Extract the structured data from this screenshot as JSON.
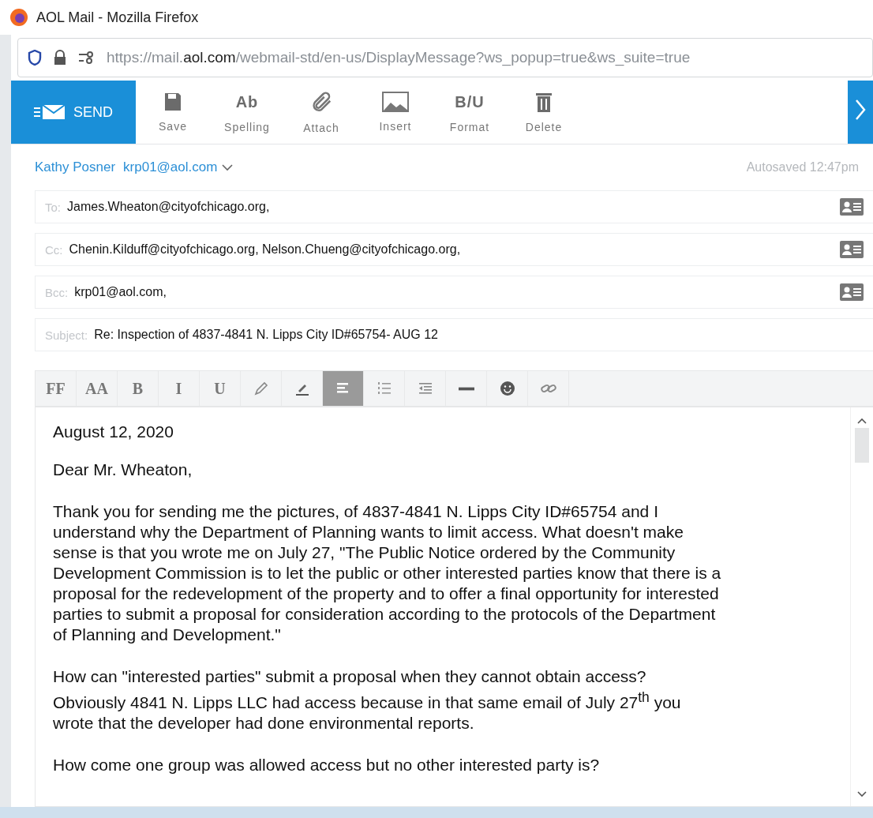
{
  "window": {
    "title": "AOL Mail - Mozilla Firefox"
  },
  "address_bar": {
    "url_start": "https://mail.",
    "url_domain": "aol.com",
    "url_rest": "/webmail-std/en-us/DisplayMessage?ws_popup=true&ws_suite=true"
  },
  "toolbar": {
    "send": "SEND",
    "actions": [
      {
        "label": "Save"
      },
      {
        "label": "Spelling",
        "glyph": "Ab"
      },
      {
        "label": "Attach"
      },
      {
        "label": "Insert"
      },
      {
        "label": "Format",
        "glyph": "B/U"
      },
      {
        "label": "Delete"
      }
    ]
  },
  "sender": {
    "name": "Kathy Posner",
    "email": "krp01@aol.com",
    "autosaved": "Autosaved 12:47pm"
  },
  "fields": [
    {
      "label": "To:",
      "value": "James.Wheaton@cityofchicago.org,",
      "contacts": true
    },
    {
      "label": "Cc:",
      "value": "Chenin.Kilduff@cityofchicago.org, Nelson.Chueng@cityofchicago.org,",
      "contacts": true
    },
    {
      "label": "Bcc:",
      "value": "krp01@aol.com,",
      "contacts": true
    },
    {
      "label": "Subject:",
      "value": "Re: Inspection of 4837-4841 N. Lipps City  ID#65754- AUG 12",
      "contacts": false
    }
  ],
  "format_bar": [
    {
      "kind": "text",
      "label": "FF",
      "selected": false
    },
    {
      "kind": "text",
      "label": "AA",
      "selected": false
    },
    {
      "kind": "text",
      "label": "B",
      "selected": false
    },
    {
      "kind": "text",
      "label": "I",
      "selected": false
    },
    {
      "kind": "text",
      "label": "U",
      "selected": false
    },
    {
      "kind": "icon",
      "selected": false
    },
    {
      "kind": "icon",
      "selected": false
    },
    {
      "kind": "icon",
      "selected": true
    },
    {
      "kind": "icon",
      "selected": false
    },
    {
      "kind": "icon",
      "selected": false
    },
    {
      "kind": "icon",
      "selected": false
    },
    {
      "kind": "icon",
      "selected": false
    },
    {
      "kind": "icon",
      "selected": false
    }
  ],
  "body": [
    [
      "August 12, 2020"
    ],
    [
      "Dear Mr. Wheaton,"
    ],
    [
      "Thank you for sending me the pictures, of 4837-4841 N. Lipps City ID#65754 and I",
      "understand why the Department of Planning wants to limit access.  What doesn't make",
      "sense is that you wrote me on July 27, \"The Public Notice ordered by the Community",
      "Development Commission is to let the public or other interested parties know that there is a",
      "proposal for the redevelopment of the property and to offer a final opportunity for interested",
      "parties to submit a proposal for consideration according to the protocols of the Department",
      "of Planning and Development.\""
    ],
    [
      "How can \"interested parties\" submit a proposal when they cannot obtain access?",
      "Obviously 4841 N. Lipps LLC had access because in that same email of July 27$^{th}$ you",
      "wrote that the developer had done environmental reports."
    ],
    [
      "How come one group was allowed access but no other interested party is?"
    ]
  ]
}
